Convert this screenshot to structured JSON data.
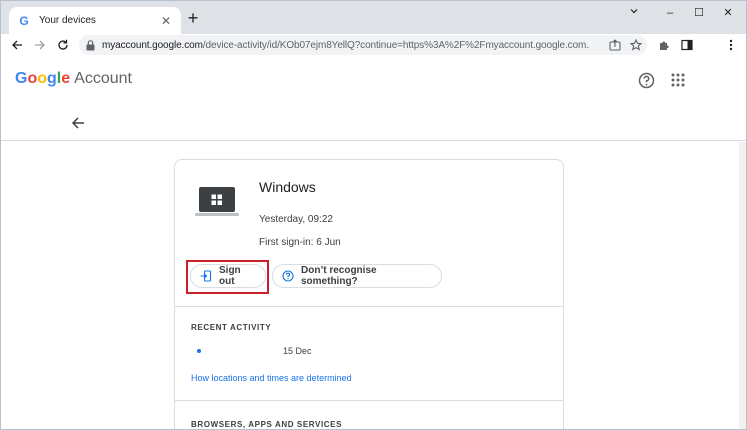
{
  "browser": {
    "tab_title": "Your devices",
    "tab_favicon_letter": "G",
    "tab_close": "✕",
    "new_tab": "+",
    "window_minimize": "–",
    "window_maximize": "☐",
    "window_close": "✕",
    "url_host": "myaccount.google.com",
    "url_rest": "/device-activity/id/KOb07ejm8YellQ?continue=https%3A%2F%2Fmyaccount.google.com..."
  },
  "header": {
    "logo_letters": [
      "G",
      "o",
      "o",
      "g",
      "l",
      "e"
    ],
    "logo_colors": [
      "#4285f4",
      "#ea4335",
      "#fbbc05",
      "#4285f4",
      "#34a853",
      "#ea4335"
    ],
    "account_label": "Account"
  },
  "device": {
    "name": "Windows",
    "last_seen": "Yesterday, 09:22",
    "first_sign_in": "First sign-in: 6 Jun",
    "sign_out_label": "Sign out",
    "dont_recognise_label": "Don’t recognise something?"
  },
  "recent_activity": {
    "title": "RECENT ACTIVITY",
    "items": [
      {
        "date": "15 Dec"
      }
    ],
    "link": "How locations and times are determined"
  },
  "browsers_section": {
    "title": "BROWSERS, APPS AND SERVICES"
  },
  "colors": {
    "accent": "#1a73e8",
    "highlight": "#c9202a"
  }
}
